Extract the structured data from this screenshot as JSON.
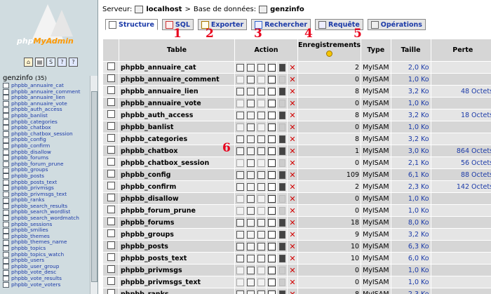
{
  "left": {
    "logo_text_php": "php",
    "logo_text_myadmin": "MyAdmin",
    "icons": [
      "home-icon",
      "query-window-icon",
      "sql-icon",
      "help-icon",
      "docs-icon"
    ],
    "db_name": "genzinfo",
    "db_count": "(35)",
    "tables": [
      "phpbb_annuaire_cat",
      "phpbb_annuaire_comment",
      "phpbb_annuaire_lien",
      "phpbb_annuaire_vote",
      "phpbb_auth_access",
      "phpbb_banlist",
      "phpbb_categories",
      "phpbb_chatbox",
      "phpbb_chatbox_session",
      "phpbb_config",
      "phpbb_confirm",
      "phpbb_disallow",
      "phpbb_forums",
      "phpbb_forum_prune",
      "phpbb_groups",
      "phpbb_posts",
      "phpbb_posts_text",
      "phpbb_privmsgs",
      "phpbb_privmsgs_text",
      "phpbb_ranks",
      "phpbb_search_results",
      "phpbb_search_wordlist",
      "phpbb_search_wordmatch",
      "phpbb_sessions",
      "phpbb_smilies",
      "phpbb_themes",
      "phpbb_themes_name",
      "phpbb_topics",
      "phpbb_topics_watch",
      "phpbb_users",
      "phpbb_user_group",
      "phpbb_vote_desc",
      "phpbb_vote_results",
      "phpbb_vote_voters"
    ]
  },
  "breadcrumb": {
    "server_label": "Serveur:",
    "server": "localhost",
    "db_label": "Base de données:",
    "db": "genzinfo"
  },
  "tabs": [
    {
      "label": "Structure",
      "icon": "structure-icon"
    },
    {
      "label": "SQL",
      "icon": "sql-icon"
    },
    {
      "label": "Exporter",
      "icon": "export-icon"
    },
    {
      "label": "Rechercher",
      "icon": "search-icon"
    },
    {
      "label": "Requête",
      "icon": "query-icon"
    },
    {
      "label": "Opérations",
      "icon": "operations-icon"
    }
  ],
  "annotations": [
    "1",
    "2",
    "3",
    "4",
    "5",
    "6"
  ],
  "columns": {
    "table": "Table",
    "action": "Action",
    "records": "Enregistrements",
    "type": "Type",
    "size": "Taille",
    "lost": "Perte"
  },
  "rows": [
    {
      "name": "phpbb_annuaire_cat",
      "records": "2",
      "type": "MyISAM",
      "size": "2,0 Ko",
      "lost": "-",
      "empty": false
    },
    {
      "name": "phpbb_annuaire_comment",
      "records": "0",
      "type": "MyISAM",
      "size": "1,0 Ko",
      "lost": "-",
      "empty": true
    },
    {
      "name": "phpbb_annuaire_lien",
      "records": "8",
      "type": "MyISAM",
      "size": "3,2 Ko",
      "lost": "48 Octets",
      "empty": false
    },
    {
      "name": "phpbb_annuaire_vote",
      "records": "0",
      "type": "MyISAM",
      "size": "1,0 Ko",
      "lost": "-",
      "empty": true
    },
    {
      "name": "phpbb_auth_access",
      "records": "8",
      "type": "MyISAM",
      "size": "3,2 Ko",
      "lost": "18 Octets",
      "empty": false
    },
    {
      "name": "phpbb_banlist",
      "records": "0",
      "type": "MyISAM",
      "size": "1,0 Ko",
      "lost": "-",
      "empty": true
    },
    {
      "name": "phpbb_categories",
      "records": "8",
      "type": "MyISAM",
      "size": "3,2 Ko",
      "lost": "-",
      "empty": false
    },
    {
      "name": "phpbb_chatbox",
      "records": "1",
      "type": "MyISAM",
      "size": "3,0 Ko",
      "lost": "864 Octets",
      "empty": false
    },
    {
      "name": "phpbb_chatbox_session",
      "records": "0",
      "type": "MyISAM",
      "size": "2,1 Ko",
      "lost": "56 Octets",
      "empty": true
    },
    {
      "name": "phpbb_config",
      "records": "109",
      "type": "MyISAM",
      "size": "6,1 Ko",
      "lost": "88 Octets",
      "empty": false
    },
    {
      "name": "phpbb_confirm",
      "records": "2",
      "type": "MyISAM",
      "size": "2,3 Ko",
      "lost": "142 Octets",
      "empty": false
    },
    {
      "name": "phpbb_disallow",
      "records": "0",
      "type": "MyISAM",
      "size": "1,0 Ko",
      "lost": "-",
      "empty": true
    },
    {
      "name": "phpbb_forum_prune",
      "records": "0",
      "type": "MyISAM",
      "size": "1,0 Ko",
      "lost": "-",
      "empty": true
    },
    {
      "name": "phpbb_forums",
      "records": "18",
      "type": "MyISAM",
      "size": "8,0 Ko",
      "lost": "-",
      "empty": false
    },
    {
      "name": "phpbb_groups",
      "records": "9",
      "type": "MyISAM",
      "size": "3,2 Ko",
      "lost": "-",
      "empty": false
    },
    {
      "name": "phpbb_posts",
      "records": "10",
      "type": "MyISAM",
      "size": "6,3 Ko",
      "lost": "-",
      "empty": false
    },
    {
      "name": "phpbb_posts_text",
      "records": "10",
      "type": "MyISAM",
      "size": "6,0 Ko",
      "lost": "-",
      "empty": false
    },
    {
      "name": "phpbb_privmsgs",
      "records": "0",
      "type": "MyISAM",
      "size": "1,0 Ko",
      "lost": "-",
      "empty": true
    },
    {
      "name": "phpbb_privmsgs_text",
      "records": "0",
      "type": "MyISAM",
      "size": "1,0 Ko",
      "lost": "-",
      "empty": true
    },
    {
      "name": "phpbb_ranks",
      "records": "8",
      "type": "MyISAM",
      "size": "2,3 Ko",
      "lost": "-",
      "empty": false
    }
  ],
  "colors": {
    "annotation": "#e8001c",
    "link": "#1b3aa8",
    "row_odd": "#e5e5e5",
    "row_even": "#d6d6d6",
    "left_bg": "#d0dce0"
  }
}
